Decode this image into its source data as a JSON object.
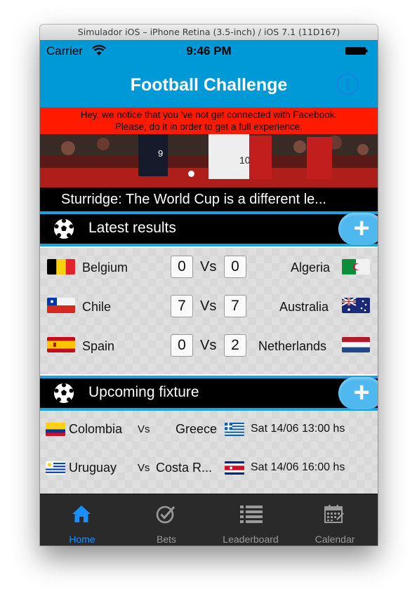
{
  "window": {
    "title": "Simulador iOS – iPhone Retina (3.5-inch) / iOS 7.1 (11D167)"
  },
  "status_bar": {
    "carrier": "Carrier",
    "time": "9:46 PM"
  },
  "nav": {
    "title": "Football Challenge",
    "info_icon": "info-icon"
  },
  "facebook_notice": {
    "line1": "Hey, we notice that you 've not get connected with Facebook.",
    "line2": "Please, do it in order to get a full experience."
  },
  "news": {
    "headline": "Sturridge: The World Cup is a different le...",
    "carousel_index": 1
  },
  "latest_results": {
    "title": "Latest results",
    "vs_label": "Vs",
    "rows": [
      {
        "home": "Belgium",
        "home_score": "0",
        "away_score": "0",
        "away": "Algeria"
      },
      {
        "home": "Chile",
        "home_score": "7",
        "away_score": "7",
        "away": "Australia"
      },
      {
        "home": "Spain",
        "home_score": "0",
        "away_score": "2",
        "away": "Netherlands"
      }
    ]
  },
  "upcoming": {
    "title": "Upcoming fixture",
    "vs_label": "Vs",
    "rows": [
      {
        "home": "Colombia",
        "away": "Greece",
        "date": "Sat 14/06 13:00 hs"
      },
      {
        "home": "Uruguay",
        "away": "Costa R...",
        "date": "Sat 14/06 16:00 hs"
      }
    ]
  },
  "tabs": [
    {
      "label": "Home",
      "icon": "home-icon",
      "active": true
    },
    {
      "label": "Bets",
      "icon": "checkmark-icon",
      "active": false
    },
    {
      "label": "Leaderboard",
      "icon": "list-icon",
      "active": false
    },
    {
      "label": "Calendar",
      "icon": "calendar-icon",
      "active": false
    }
  ],
  "colors": {
    "accent": "#0099d8",
    "banner": "#ff1a00",
    "tab_active": "#1a8fff",
    "tabbar_bg": "#2a2a2a"
  }
}
